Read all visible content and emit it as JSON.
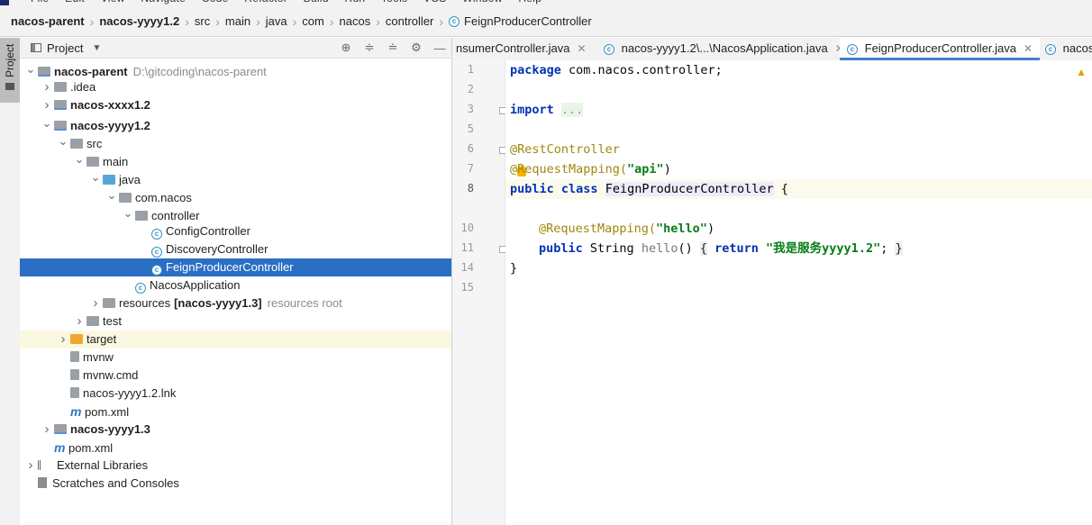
{
  "menu": {
    "items": [
      "File",
      "Edit",
      "View",
      "Navigate",
      "Code",
      "Refactor",
      "Build",
      "Run",
      "Tools",
      "VCS",
      "Window",
      "Help"
    ]
  },
  "breadcrumb": [
    "nacos-parent",
    "nacos-yyyy1.2",
    "src",
    "main",
    "java",
    "com",
    "nacos",
    "controller",
    "FeignProducerController"
  ],
  "project_panel": {
    "title": "Project",
    "side_tab": "Project",
    "tree": [
      {
        "label": "nacos-parent",
        "extra": "D:\\gitcoding\\nacos-parent",
        "level": 0,
        "arrow": "down",
        "icon": "module",
        "bold": true
      },
      {
        "label": ".idea",
        "level": 1,
        "arrow": "right",
        "icon": "folder"
      },
      {
        "label": "nacos-xxxx1.2",
        "level": 1,
        "arrow": "right",
        "icon": "module",
        "bold": true
      },
      {
        "label": "nacos-yyyy1.2",
        "level": 1,
        "arrow": "down",
        "icon": "module",
        "bold": true
      },
      {
        "label": "src",
        "level": 2,
        "arrow": "down",
        "icon": "folder"
      },
      {
        "label": "main",
        "level": 3,
        "arrow": "down",
        "icon": "folder"
      },
      {
        "label": "java",
        "level": 4,
        "arrow": "down",
        "icon": "folder-blue"
      },
      {
        "label": "com.nacos",
        "level": 5,
        "arrow": "down",
        "icon": "folder"
      },
      {
        "label": "controller",
        "level": 6,
        "arrow": "down",
        "icon": "folder"
      },
      {
        "label": "ConfigController",
        "level": 7,
        "arrow": "",
        "icon": "class"
      },
      {
        "label": "DiscoveryController",
        "level": 7,
        "arrow": "",
        "icon": "class"
      },
      {
        "label": "FeignProducerController",
        "level": 7,
        "arrow": "",
        "icon": "class",
        "selected": true
      },
      {
        "label": "NacosApplication",
        "level": 6,
        "arrow": "",
        "icon": "class"
      },
      {
        "label": "resources",
        "bold_extra": "[nacos-yyyy1.3]",
        "extra": "resources root",
        "level": 4,
        "arrow": "right",
        "icon": "folder"
      },
      {
        "label": "test",
        "level": 3,
        "arrow": "right",
        "icon": "folder"
      },
      {
        "label": "target",
        "level": 2,
        "arrow": "right",
        "icon": "folder-orange",
        "highlight": true
      },
      {
        "label": "mvnw",
        "level": 2,
        "arrow": "",
        "icon": "file"
      },
      {
        "label": "mvnw.cmd",
        "level": 2,
        "arrow": "",
        "icon": "file"
      },
      {
        "label": "nacos-yyyy1.2.lnk",
        "level": 2,
        "arrow": "",
        "icon": "file"
      },
      {
        "label": "pom.xml",
        "level": 2,
        "arrow": "",
        "icon": "maven"
      },
      {
        "label": "nacos-yyyy1.3",
        "level": 1,
        "arrow": "right",
        "icon": "module",
        "bold": true
      },
      {
        "label": "pom.xml",
        "level": 1,
        "arrow": "",
        "icon": "maven"
      },
      {
        "label": "External Libraries",
        "level": 0,
        "arrow": "right",
        "icon": "library"
      },
      {
        "label": "Scratches and Consoles",
        "level": 0,
        "arrow": "",
        "icon": "scratch"
      }
    ]
  },
  "editor": {
    "tabs": [
      {
        "label": "nsumerController.java",
        "icon": false,
        "active": false
      },
      {
        "label": "nacos-yyyy1.2\\...\\NacosApplication.java",
        "icon": true,
        "active": false
      },
      {
        "label": "FeignProducerController.java",
        "icon": true,
        "active": true
      },
      {
        "label": "nacos",
        "icon": true,
        "active": false
      }
    ],
    "line_numbers": [
      "1",
      "2",
      "3",
      "5",
      "6",
      "7",
      "8",
      "10",
      "11",
      "14",
      "15"
    ],
    "code": {
      "l1_kw": "package",
      "l1_rest": " com.nacos.controller;",
      "l3_kw": "import",
      "l3_fold": "...",
      "l6": "@RestController",
      "l7_a": "@RequestMapping(",
      "l7_s": "\"api\"",
      "l7_b": ")",
      "l8_kw": "public class",
      "l8_cls": "FeignProducerController",
      "l8_b": " {",
      "l10_a": "@RequestMapping(",
      "l10_s": "\"hello\"",
      "l10_b": ")",
      "l11_kw1": "public",
      "l11_t": " String ",
      "l11_m": "hello",
      "l11_p": "() ",
      "l11_br1": "{",
      "l11_kw2": "return",
      "l11_s": "\"我是服务yyyy1.2\"",
      "l11_sc": "; ",
      "l11_br2": "}",
      "l14": "}"
    }
  }
}
